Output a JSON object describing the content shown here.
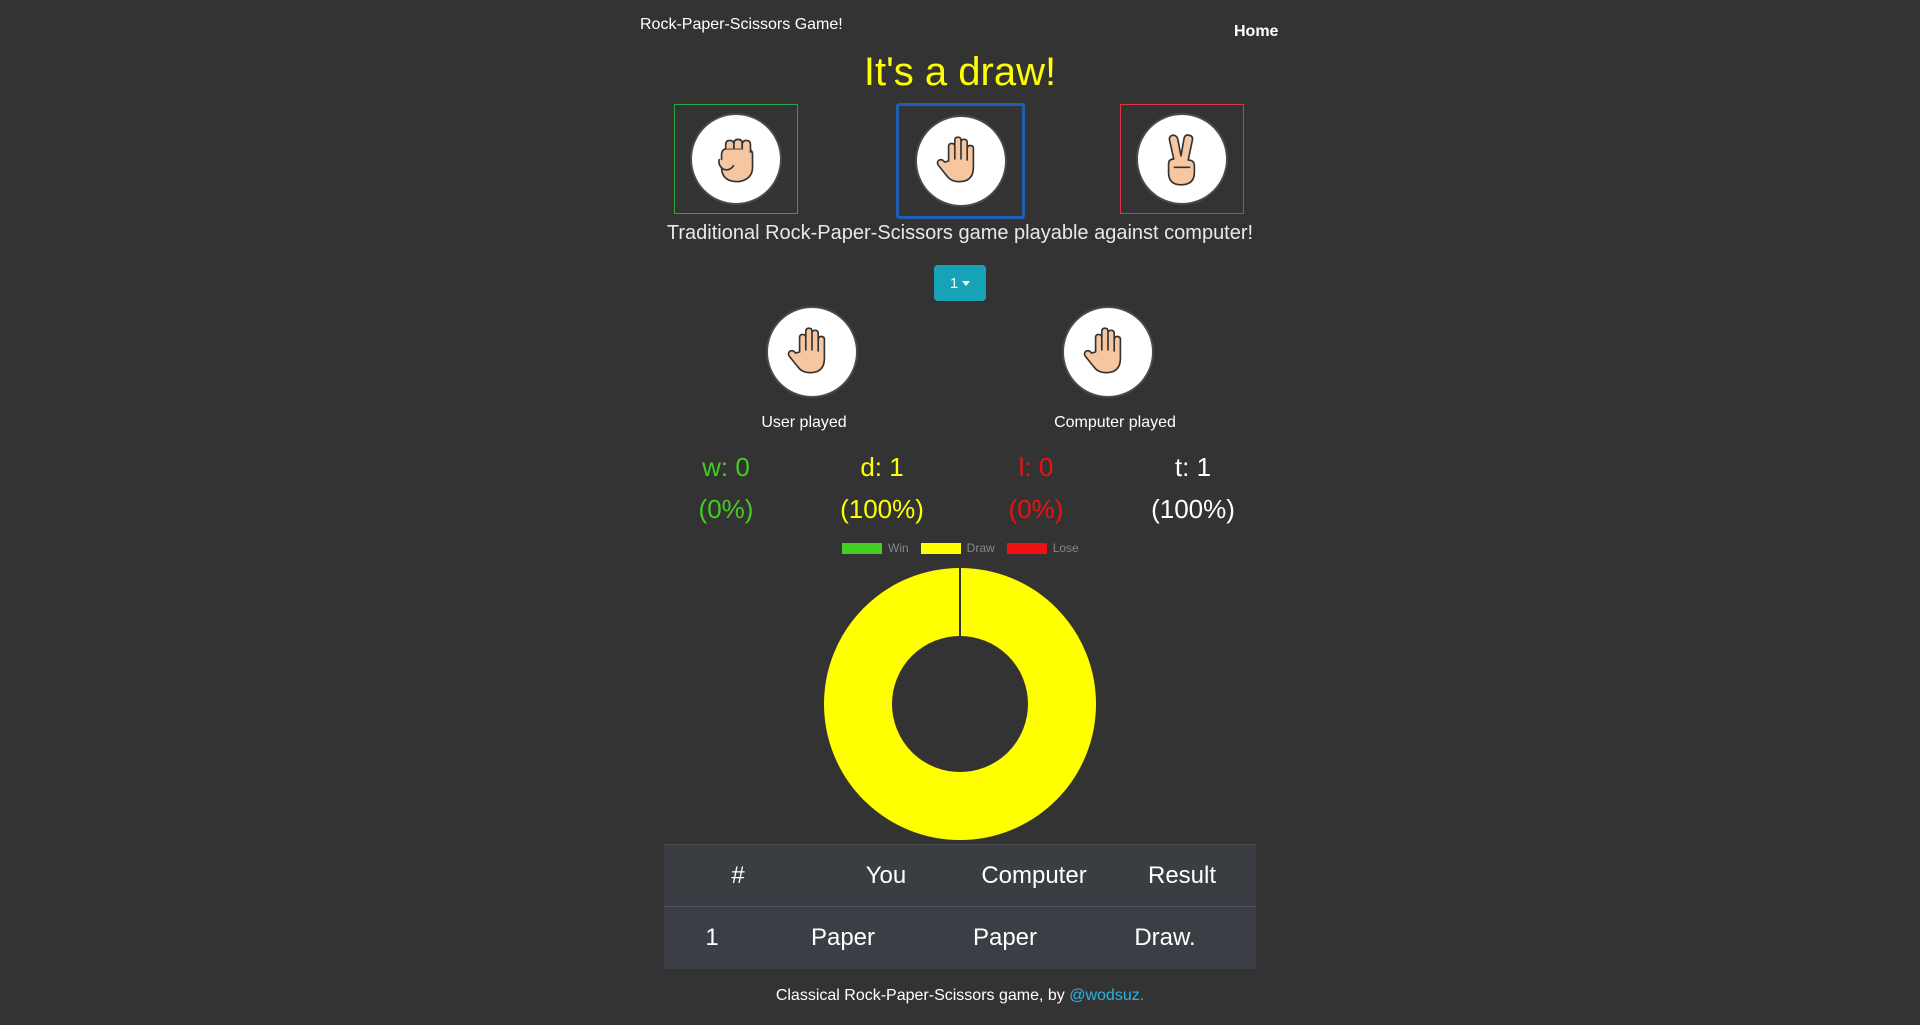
{
  "nav": {
    "brand": "Rock-Paper-Scissors Game!",
    "home_label": "Home"
  },
  "headline": "It's a draw!",
  "choices": [
    {
      "name": "rock",
      "icon": "rock-hand-icon",
      "border_color": "#28a745"
    },
    {
      "name": "paper",
      "icon": "paper-hand-icon",
      "border_color": "#1e5fb4",
      "selected": true
    },
    {
      "name": "scissors",
      "icon": "scissors-hand-icon",
      "border_color": "#dc3545"
    }
  ],
  "description": "Traditional Rock-Paper-Scissors game playable against computer!",
  "rounds_dropdown": {
    "selected": "1"
  },
  "user_played": {
    "label": "User played",
    "icon": "paper-hand-icon"
  },
  "computer_played": {
    "label": "Computer played",
    "icon": "paper-hand-icon"
  },
  "stats": {
    "wins": {
      "label": "w: 0",
      "percent": "(0%)",
      "color": "#44cc22"
    },
    "draws": {
      "label": "d: 1",
      "percent": "(100%)",
      "color": "#ffff00"
    },
    "losses": {
      "label": "l: 0",
      "percent": "(0%)",
      "color": "#ee1111"
    },
    "total": {
      "label": "t: 1",
      "percent": "(100%)",
      "color": "#ffffff"
    }
  },
  "chart_data": {
    "type": "pie",
    "categories": [
      "Win",
      "Draw",
      "Lose"
    ],
    "values": [
      0,
      1,
      0
    ],
    "colors": [
      "#44cc22",
      "#ffff00",
      "#ee1111"
    ],
    "donut": true,
    "legend": "top"
  },
  "history_table": {
    "headers": [
      "#",
      "You",
      "Computer",
      "Result"
    ],
    "rows": [
      [
        "1",
        "Paper",
        "Paper",
        "Draw."
      ]
    ]
  },
  "footer": {
    "text": "Classical Rock-Paper-Scissors game, by ",
    "link_text": "@wodsuz."
  }
}
